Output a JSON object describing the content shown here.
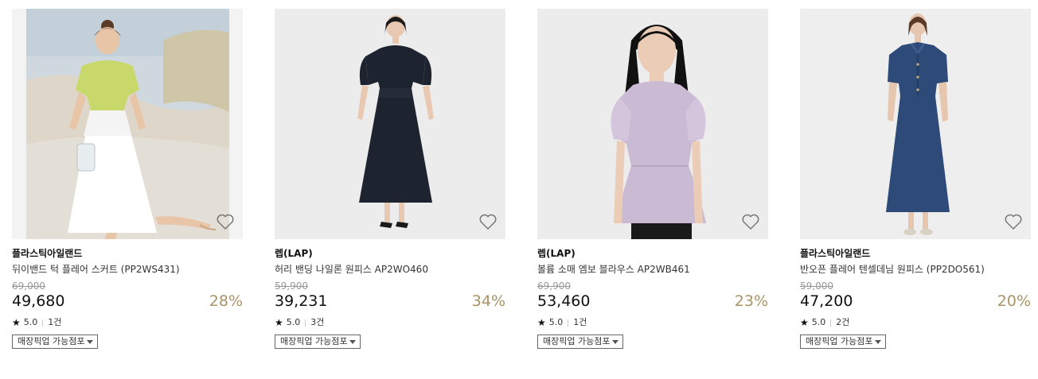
{
  "pickup_label": "매장픽업 가능점포",
  "products": [
    {
      "brand": "플라스틱아일랜드",
      "name": "뒤이밴드 턱 플레어 스커트 (PP2WS431)",
      "original_price": "69,000",
      "price": "49,680",
      "discount": "28%",
      "rating": "5.0",
      "reviews": "1건"
    },
    {
      "brand": "렙(LAP)",
      "name": "허리 밴딩 나일론 원피스 AP2WO460",
      "original_price": "59,900",
      "price": "39,231",
      "discount": "34%",
      "rating": "5.0",
      "reviews": "3건"
    },
    {
      "brand": "렙(LAP)",
      "name": "볼륨 소매 엠보 블라우스 AP2WB461",
      "original_price": "69,900",
      "price": "53,460",
      "discount": "23%",
      "rating": "5.0",
      "reviews": "1건"
    },
    {
      "brand": "플라스틱아일랜드",
      "name": "반오픈 플레어 텐셀데님 원피스 (PP2DO561)",
      "original_price": "59,000",
      "price": "47,200",
      "discount": "20%",
      "rating": "5.0",
      "reviews": "2건"
    }
  ],
  "colors": {
    "discount": "#a99366",
    "strike": "#999999"
  },
  "icons": {
    "wishlist": "heart-outline-icon",
    "rating": "star-icon",
    "dropdown": "caret-down-icon"
  }
}
